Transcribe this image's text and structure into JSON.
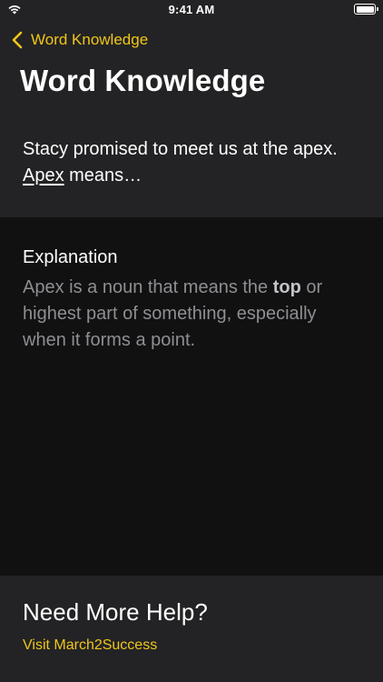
{
  "status_bar": {
    "time": "9:41 AM"
  },
  "nav": {
    "back_label": "Word Knowledge"
  },
  "page_title": "Word Knowledge",
  "question": {
    "before": "Stacy promised to meet us at the apex. ",
    "word": "Apex",
    "after": " means…"
  },
  "explanation": {
    "heading": "Explanation",
    "before": "Apex is a noun that means the ",
    "bold": "top",
    "after": " or highest part of something, especially when it forms a point."
  },
  "help": {
    "heading": "Need More Help?",
    "link": "Visit March2Success"
  },
  "colors": {
    "accent": "#f0c61a",
    "background": "#111112",
    "panel": "#232325",
    "muted_text": "#8e8e93"
  }
}
